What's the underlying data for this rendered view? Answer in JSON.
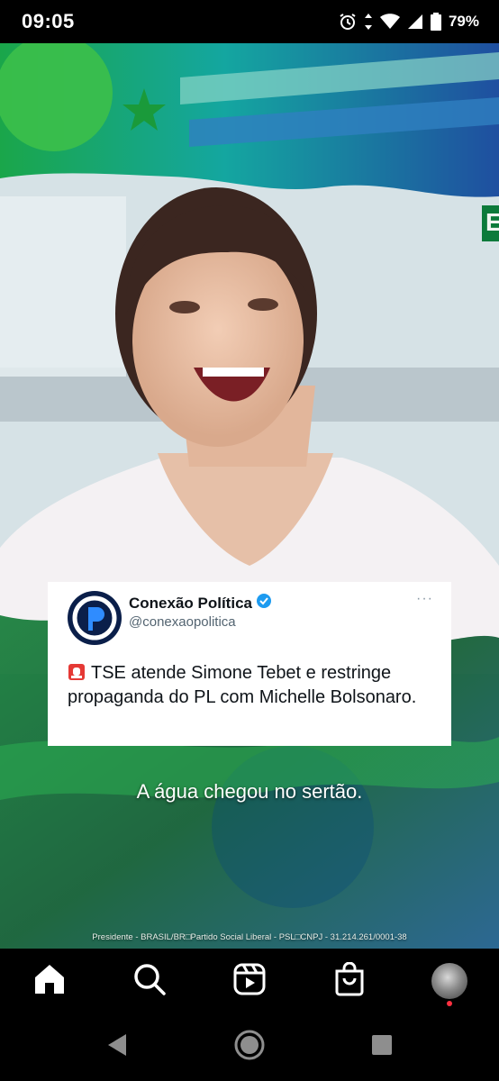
{
  "status_bar": {
    "time": "09:05",
    "battery": "79%"
  },
  "tweet": {
    "name": "Conexão Política",
    "handle": "@conexaopolitica",
    "more": "···",
    "text": "TSE atende Simone Tebet e restringe propaganda do PL com Michelle Bolsonaro."
  },
  "video": {
    "caption": "A água chegou no sertão.",
    "legal_line": "Presidente - BRASIL/BR□Partido Social Liberal - PSL□CNPJ - 31.214.261/0001-38",
    "side_letter": "E"
  },
  "colors": {
    "brand_green": "#14a83c",
    "brand_blue": "#1f4fa0",
    "verified_blue": "#1d9bf0",
    "notification_red": "#ff3040"
  },
  "icons": {
    "bottom_nav": [
      "home-icon",
      "search-icon",
      "reels-icon",
      "shop-icon",
      "profile-avatar"
    ],
    "system_nav": [
      "back-icon",
      "home-circle-icon",
      "recents-icon"
    ]
  }
}
